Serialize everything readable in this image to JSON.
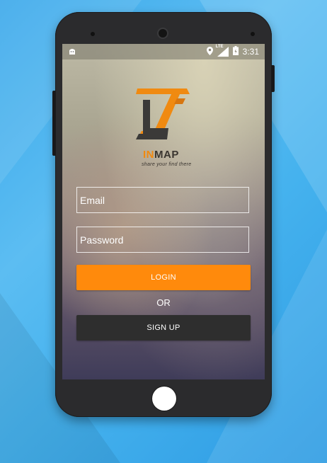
{
  "status_bar": {
    "time": "3:31",
    "network": "LTE",
    "icons": [
      "android-icon",
      "location-icon",
      "signal-icon",
      "battery-icon"
    ]
  },
  "brand": {
    "name_accent": "IN",
    "name_rest": "MAP",
    "tagline": "share your find there"
  },
  "form": {
    "email_placeholder": "Email",
    "password_placeholder": "Password",
    "login_label": "LOGIN",
    "or_label": "OR",
    "signup_label": "SIGN UP"
  },
  "colors": {
    "accent": "#ff8a0c",
    "signup_bg": "#2e2e2e",
    "background": "#45b2ee"
  }
}
